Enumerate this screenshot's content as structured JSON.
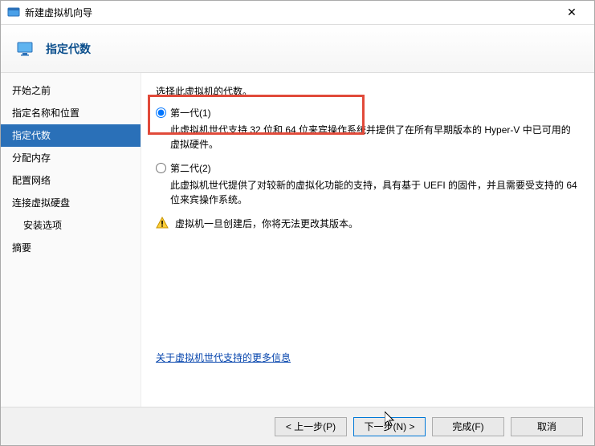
{
  "window": {
    "title": "新建虚拟机向导"
  },
  "banner": {
    "title": "指定代数"
  },
  "sidebar": {
    "items": [
      {
        "label": "开始之前",
        "active": false,
        "indent": false
      },
      {
        "label": "指定名称和位置",
        "active": false,
        "indent": false
      },
      {
        "label": "指定代数",
        "active": true,
        "indent": false
      },
      {
        "label": "分配内存",
        "active": false,
        "indent": false
      },
      {
        "label": "配置网络",
        "active": false,
        "indent": false
      },
      {
        "label": "连接虚拟硬盘",
        "active": false,
        "indent": false
      },
      {
        "label": "安装选项",
        "active": false,
        "indent": true
      },
      {
        "label": "摘要",
        "active": false,
        "indent": false
      }
    ]
  },
  "content": {
    "intro": "选择此虚拟机的代数。",
    "option1": {
      "label": "第一代(1)",
      "desc": "此虚拟机世代支持 32 位和 64 位来宾操作系统并提供了在所有早期版本的 Hyper-V 中已可用的虚拟硬件。"
    },
    "option2": {
      "label": "第二代(2)",
      "desc": "此虚拟机世代提供了对较新的虚拟化功能的支持，具有基于 UEFI 的固件，并且需要受支持的 64 位来宾操作系统。"
    },
    "warning": "虚拟机一旦创建后，你将无法更改其版本。",
    "link": "关于虚拟机世代支持的更多信息"
  },
  "footer": {
    "prev": "< 上一步(P)",
    "next": "下一步(N) >",
    "finish": "完成(F)",
    "cancel": "取消"
  }
}
